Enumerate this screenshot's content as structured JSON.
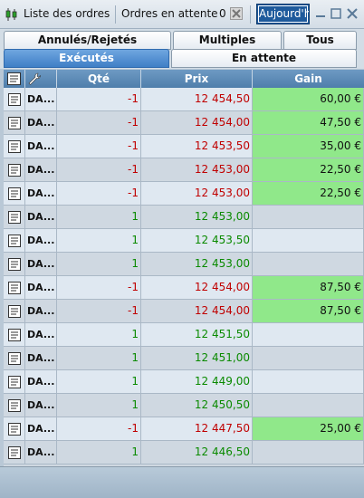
{
  "titlebar": {
    "title": "Liste des ordres",
    "pending_label": "Ordres en attente",
    "pending_count": "0",
    "period": "Aujourd'hui"
  },
  "tabs": {
    "row1": [
      "Annulés/Rejetés",
      "Multiples",
      "Tous"
    ],
    "row2": [
      "Exécutés",
      "En attente"
    ],
    "active": "Exécutés"
  },
  "table": {
    "headers": [
      "Qté",
      "Prix",
      "Gain"
    ],
    "rows": [
      {
        "name": "DA...",
        "qty": "-1",
        "price": "12 454,50",
        "gain": "60,00 €"
      },
      {
        "name": "DA...",
        "qty": "-1",
        "price": "12 454,00",
        "gain": "47,50 €"
      },
      {
        "name": "DA...",
        "qty": "-1",
        "price": "12 453,50",
        "gain": "35,00 €"
      },
      {
        "name": "DA...",
        "qty": "-1",
        "price": "12 453,00",
        "gain": "22,50 €"
      },
      {
        "name": "DA...",
        "qty": "-1",
        "price": "12 453,00",
        "gain": "22,50 €"
      },
      {
        "name": "DA...",
        "qty": "1",
        "price": "12 453,00",
        "gain": ""
      },
      {
        "name": "DA...",
        "qty": "1",
        "price": "12 453,50",
        "gain": ""
      },
      {
        "name": "DA...",
        "qty": "1",
        "price": "12 453,00",
        "gain": ""
      },
      {
        "name": "DA...",
        "qty": "-1",
        "price": "12 454,00",
        "gain": "87,50 €"
      },
      {
        "name": "DA...",
        "qty": "-1",
        "price": "12 454,00",
        "gain": "87,50 €"
      },
      {
        "name": "DA...",
        "qty": "1",
        "price": "12 451,50",
        "gain": ""
      },
      {
        "name": "DA...",
        "qty": "1",
        "price": "12 451,00",
        "gain": ""
      },
      {
        "name": "DA...",
        "qty": "1",
        "price": "12 449,00",
        "gain": ""
      },
      {
        "name": "DA...",
        "qty": "1",
        "price": "12 450,50",
        "gain": ""
      },
      {
        "name": "DA...",
        "qty": "-1",
        "price": "12 447,50",
        "gain": "25,00 €"
      },
      {
        "name": "DA...",
        "qty": "1",
        "price": "12 446,50",
        "gain": ""
      }
    ]
  },
  "colors": {
    "negative": "#c00000",
    "positive": "#0a8a00",
    "gain_highlight": "#90e88a",
    "active_tab": "#3f7fc6",
    "header": "#5a88b5"
  }
}
